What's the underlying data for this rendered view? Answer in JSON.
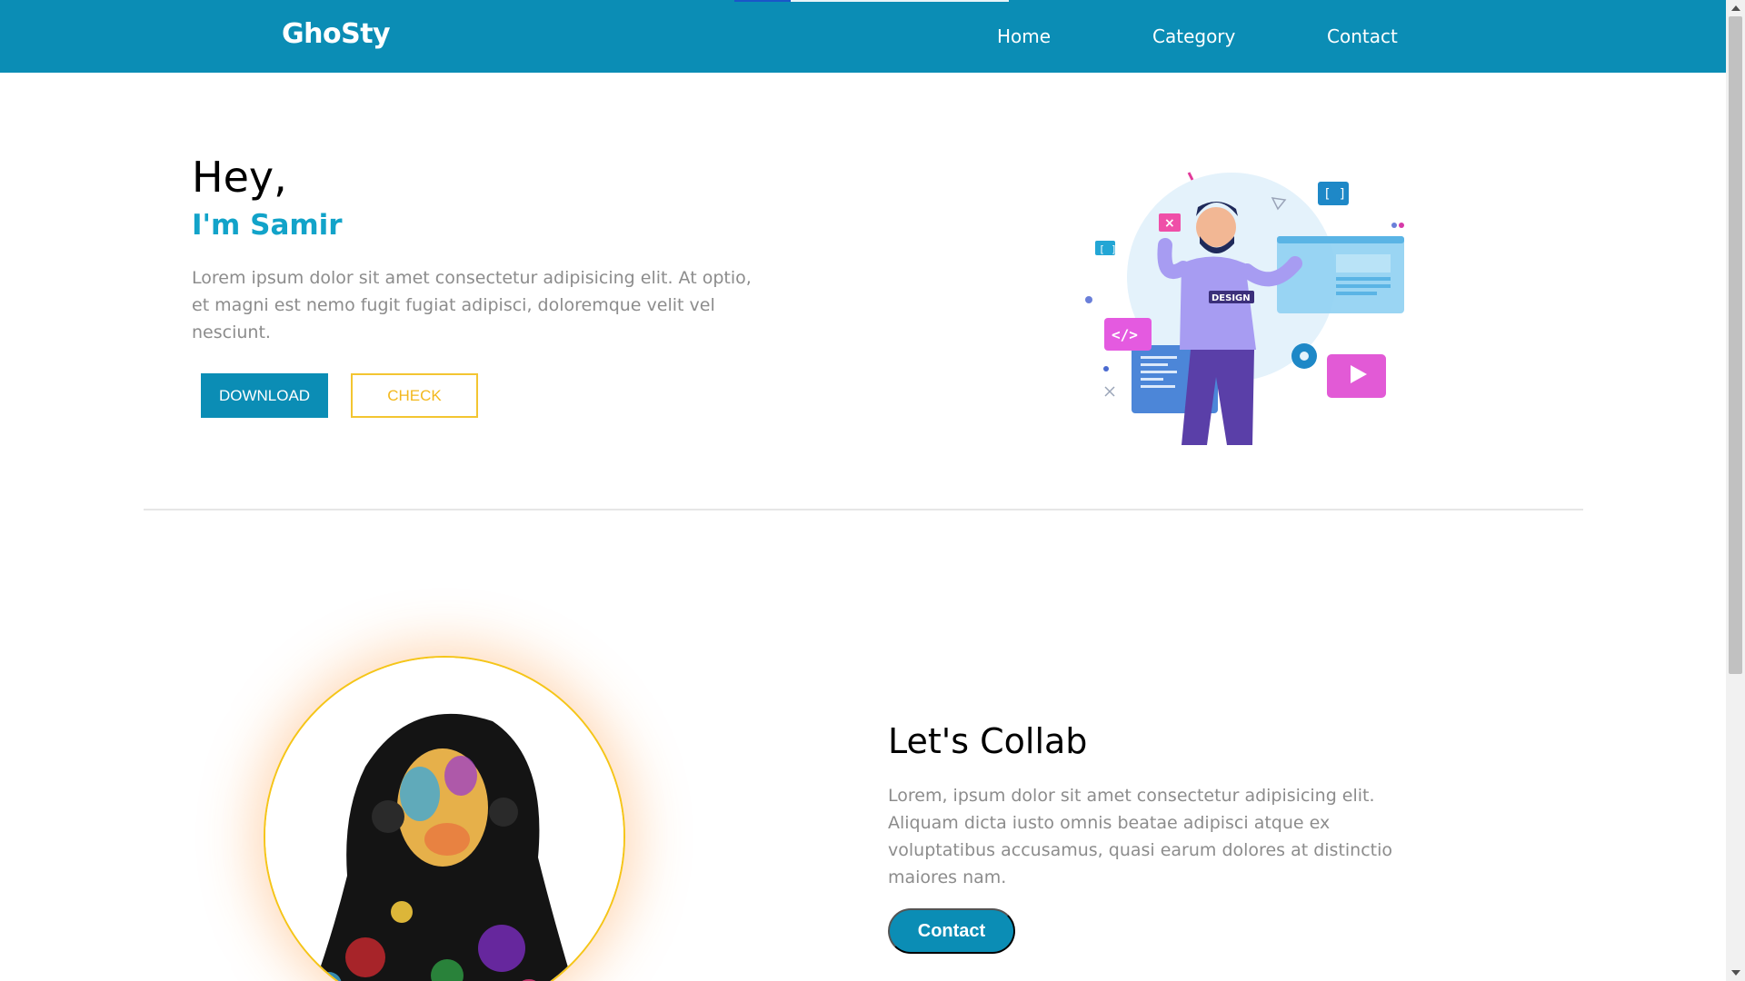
{
  "nav": {
    "brand": "GhoSty",
    "links": [
      "Home",
      "Category",
      "Contact"
    ]
  },
  "hero": {
    "title": "Hey,",
    "subtitle": "I'm Samir",
    "text": "Lorem ipsum dolor sit amet consectetur adipisicing elit. At optio, et magni est nemo fugit fugiat adipisci, doloremque velit vel nesciunt.",
    "download_label": "DOWNLOAD",
    "check_label": "CHECK",
    "illustration_badge": "DESIGN"
  },
  "collab": {
    "title": "Let's Collab",
    "text": "Lorem, ipsum dolor sit amet consectetur adipisicing elit. Aliquam dicta iusto omnis beatae adipisci atque ex voluptatibus accusamus, quasi earum dolores at distinctio maiores nam.",
    "button_label": "Contact"
  },
  "colors": {
    "primary": "#0b8db5",
    "accent_text": "#12a3c9",
    "secondary": "#f3b81c",
    "body_text": "#8c8c8c"
  }
}
